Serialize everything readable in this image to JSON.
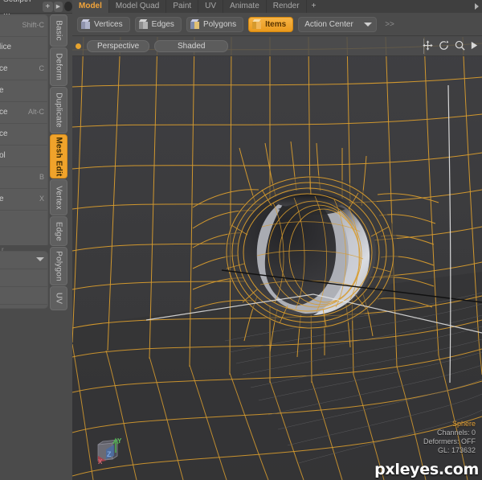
{
  "app": {
    "name": "Modo",
    "accent": "#f0a32b",
    "panel_bg": "#4b4b4b",
    "viewport_bg": "#3b3b3d",
    "wireframe_color": "#e0a030"
  },
  "left_tabstrip": {
    "label": "Sculpt/P ...",
    "add_label": "+",
    "arrow_label": "▶"
  },
  "tool_list": {
    "rows": [
      {
        "name": "",
        "key": "Shift-C"
      },
      {
        "name": "lice",
        "key": ""
      },
      {
        "name": "ce",
        "key": "C"
      },
      {
        "name": "e",
        "key": ""
      },
      {
        "name": "ce",
        "key": "Alt-C"
      },
      {
        "name": "ce",
        "key": ""
      },
      {
        "name": "ol",
        "key": ""
      },
      {
        "name": "",
        "key": "B"
      },
      {
        "name": "e",
        "key": "X"
      }
    ],
    "separator_label": "r",
    "rows2": [
      {
        "name": "",
        "key": ""
      },
      {
        "name": "",
        "key": ""
      },
      {
        "name": "",
        "key": ""
      }
    ]
  },
  "vertical_tabs": {
    "items": [
      {
        "label": "Basic",
        "active": false
      },
      {
        "label": "Deform",
        "active": false
      },
      {
        "label": "Duplicate",
        "active": false
      },
      {
        "label": "Mesh Edit",
        "active": true
      },
      {
        "label": "Vertex",
        "active": false
      },
      {
        "label": "Edge",
        "active": false
      },
      {
        "label": "Polygon",
        "active": false
      },
      {
        "label": "UV",
        "active": false
      }
    ]
  },
  "menu_tabs": {
    "items": [
      {
        "label": "Model",
        "active": true
      },
      {
        "label": "Model Quad",
        "active": false
      },
      {
        "label": "Paint",
        "active": false
      },
      {
        "label": "UV",
        "active": false
      },
      {
        "label": "Animate",
        "active": false
      },
      {
        "label": "Render",
        "active": false
      },
      {
        "label": "+",
        "active": false
      }
    ]
  },
  "mode_bar": {
    "buttons": [
      {
        "label": "Vertices",
        "icon": "cube-icon",
        "active": false
      },
      {
        "label": "Edges",
        "icon": "cube-edge-icon",
        "active": false
      },
      {
        "label": "Polygons",
        "icon": "cube-poly-icon",
        "active": false
      },
      {
        "label": "Items",
        "icon": "cube-item-icon",
        "active": true
      }
    ],
    "action_center_label": "Action Center",
    "more_label": ">>"
  },
  "viewport": {
    "view_mode": "Perspective",
    "shading_mode": "Shaded",
    "nav_icons": [
      "pan-icon",
      "rotate-icon",
      "zoom-icon",
      "play-icon"
    ],
    "status": {
      "object": "Sphere",
      "channels": "Channels: 0",
      "deformers": "Deformers: OFF",
      "gl": "GL: 173632"
    },
    "gizmo": {
      "x": "X",
      "y": "Y",
      "z": "Z"
    }
  },
  "watermark": {
    "text": "pxleyes.com"
  }
}
